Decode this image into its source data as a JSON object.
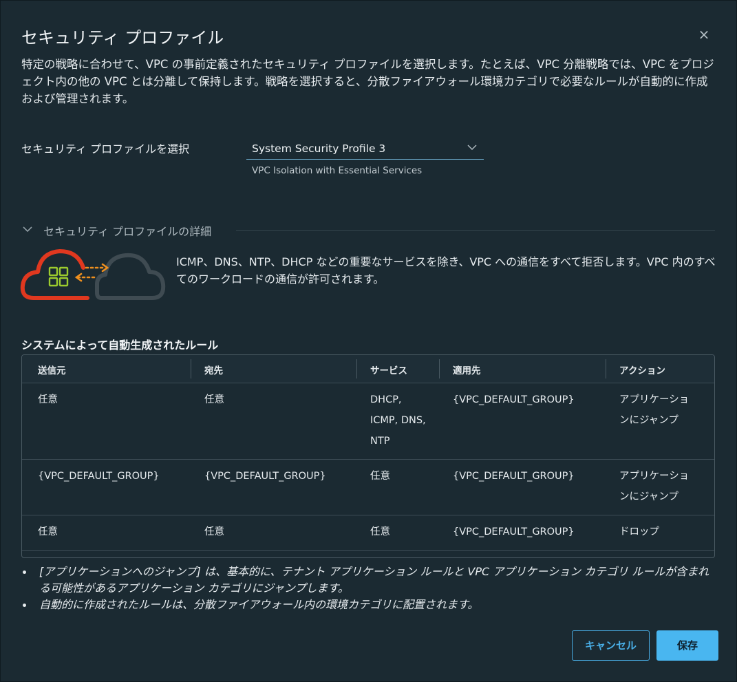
{
  "dialog": {
    "title": "セキュリティ プロファイル",
    "close_label": "×",
    "description": "特定の戦略に合わせて、VPC の事前定義されたセキュリティ プロファイルを選択します。たとえば、VPC 分離戦略では、VPC をプロジェクト内の他の VPC とは分離して保持します。戦略を選択すると、分散ファイアウォール環境カテゴリで必要なルールが自動的に作成および管理されます。"
  },
  "profile_select": {
    "label": "セキュリティ プロファイルを選択",
    "value": "System Security Profile 3",
    "helper": "VPC Isolation with Essential Services"
  },
  "details": {
    "title": "セキュリティ プロファイルの詳細",
    "description": "ICMP、DNS、NTP、DHCP などの重要なサービスを除き、VPC への通信をすべて拒否します。VPC 内のすべてのワークロードの通信が許可されます。"
  },
  "rules": {
    "heading": "システムによって自動生成されたルール",
    "columns": [
      "送信元",
      "宛先",
      "サービス",
      "適用先",
      "アクション"
    ],
    "rows": [
      {
        "source": "任意",
        "destination": "任意",
        "service_lines": [
          "DHCP,",
          "ICMP, DNS,",
          "NTP"
        ],
        "applied_to": "{VPC_DEFAULT_GROUP}",
        "action_lines": [
          "アプリケーショ",
          "ンにジャンプ"
        ]
      },
      {
        "source": "{VPC_DEFAULT_GROUP}",
        "destination": "{VPC_DEFAULT_GROUP}",
        "service_lines": [
          "任意"
        ],
        "applied_to": "{VPC_DEFAULT_GROUP}",
        "action_lines": [
          "アプリケーショ",
          "ンにジャンプ"
        ]
      },
      {
        "source": "任意",
        "destination": "任意",
        "service_lines": [
          "任意"
        ],
        "applied_to": "{VPC_DEFAULT_GROUP}",
        "action_lines": [
          "ドロップ"
        ]
      }
    ]
  },
  "notes": [
    "[アプリケーションへのジャンプ] は、基本的に、テナント アプリケーション ルールと VPC アプリケーション カテゴリ ルールが含まれる可能性があるアプリケーション カテゴリにジャンプします。",
    "自動的に作成されたルールは、分散ファイアウォール内の環境カテゴリに配置されます。"
  ],
  "buttons": {
    "cancel": "キャンセル",
    "save": "保存"
  },
  "colors": {
    "background": "#1b2a32",
    "accent": "#49b6f0",
    "cloud_red": "#e0381f",
    "cloud_gray": "#3f4b52",
    "arrow_orange": "#f0901e",
    "grid_green": "#9ccc2e"
  }
}
